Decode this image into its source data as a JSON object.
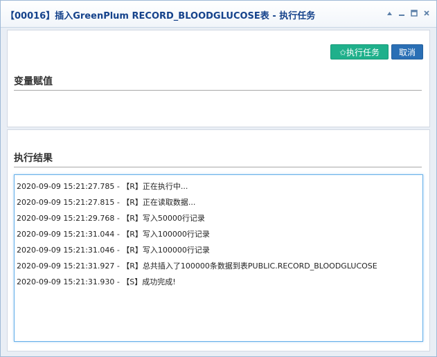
{
  "window": {
    "title": "【00016】插入GreenPlum RECORD_BLOODGLUCOSE表 - 执行任务"
  },
  "toolbar": {
    "run_label": "✩执行任务",
    "cancel_label": "取消"
  },
  "sections": {
    "variables_title": "变量赋值",
    "results_title": "执行结果"
  },
  "log": [
    "2020-09-09 15:21:27.785 - 【R】正在执行中...",
    "2020-09-09 15:21:27.815 - 【R】正在读取数据...",
    "2020-09-09 15:21:29.768 - 【R】写入50000行记录",
    "2020-09-09 15:21:31.044 - 【R】写入100000行记录",
    "2020-09-09 15:21:31.046 - 【R】写入100000行记录",
    "2020-09-09 15:21:31.927 - 【R】总共插入了100000条数据到表PUBLIC.RECORD_BLOODGLUCOSE",
    "2020-09-09 15:21:31.930 - 【S】成功完成!"
  ],
  "icons": {
    "collapse": "triangle-up-icon",
    "minimize": "minimize-icon",
    "maximize": "maximize-icon",
    "close": "close-icon"
  },
  "colors": {
    "title_text": "#15428b",
    "run_button": "#1fb08b",
    "cancel_button": "#2a6fb5",
    "log_border": "#66afe9"
  }
}
